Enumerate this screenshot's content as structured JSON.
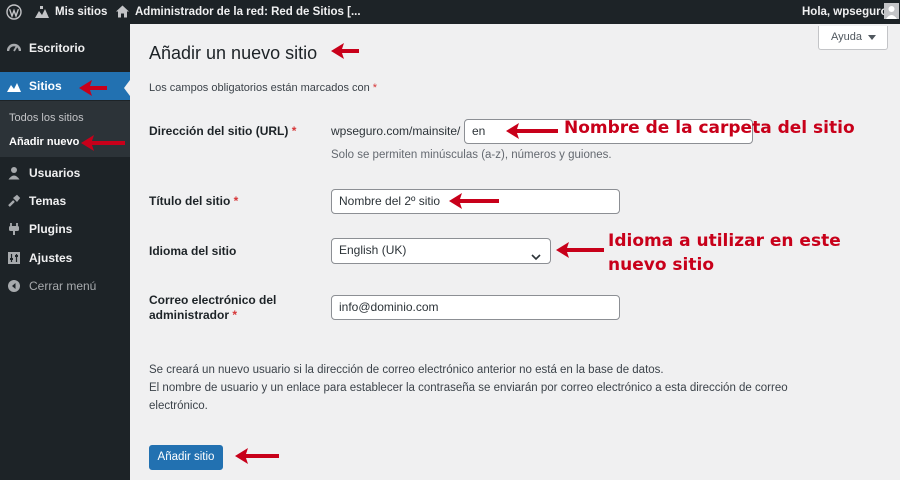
{
  "admin_bar": {
    "wp_logo_icon": "wordpress-logo-icon",
    "my_sites": "Mis sitios",
    "site_name": "Administrador de la red: Red de Sitios [...",
    "greeting": "Hola, wpseguro"
  },
  "sidebar": {
    "items": [
      {
        "label": "Escritorio",
        "icon": "dashboard-icon"
      },
      {
        "label": "Sitios",
        "icon": "sites-icon"
      },
      {
        "label": "Usuarios",
        "icon": "users-icon"
      },
      {
        "label": "Temas",
        "icon": "themes-icon"
      },
      {
        "label": "Plugins",
        "icon": "plugins-icon"
      },
      {
        "label": "Ajustes",
        "icon": "settings-icon"
      },
      {
        "label": "Cerrar menú",
        "icon": "collapse-icon"
      }
    ],
    "submenu": [
      "Todos los sitios",
      "Añadir nuevo"
    ]
  },
  "page": {
    "help_tab": "Ayuda",
    "title": "Añadir un nuevo sitio",
    "required_note": "Los campos obligatorios están marcados con",
    "asterisk": "*"
  },
  "form": {
    "url_label": "Dirección del sitio (URL)",
    "url_prefix": "wpseguro.com/mainsite/",
    "url_value": "en",
    "url_hint": "Solo se permiten minúsculas (a-z), números y guiones.",
    "title_label": "Título del sitio",
    "title_value": "Nombre del 2º sitio",
    "language_label": "Idioma del sitio",
    "language_value": "English (UK)",
    "email_label_line1": "Correo electrónico del",
    "email_label_line2": "administrador",
    "email_value": "info@dominio.com",
    "note_line1": "Se creará un nuevo usuario si la dirección de correo electrónico anterior no está en la base de datos.",
    "note_line2": "El nombre de usuario y un enlace para establecer la contraseña se enviarán por correo electrónico a esta dirección de correo",
    "note_line3": "electrónico.",
    "submit_label": "Añadir sitio"
  },
  "annotations": {
    "folder_note": "Nombre de la carpeta del sitio",
    "language_note_line1": "Idioma a utilizar en este",
    "language_note_line2": "nuevo sitio",
    "arrow_color": "#c8001a"
  },
  "colors": {
    "admin_dark": "#1d2327",
    "accent_blue": "#2271b1",
    "required_red": "#d63638"
  }
}
